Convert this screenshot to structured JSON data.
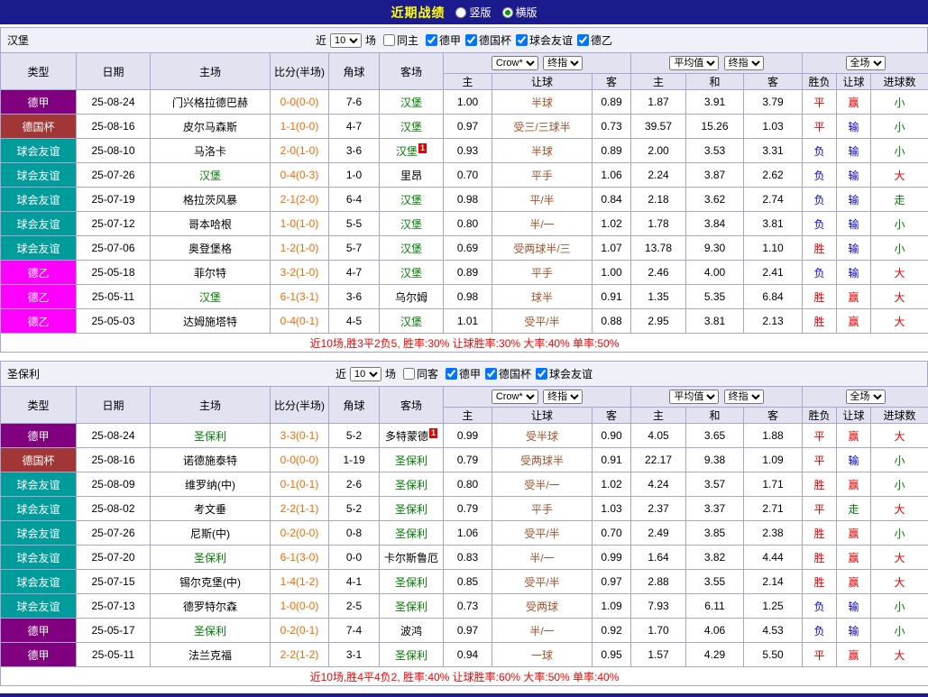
{
  "titlebar": {
    "title": "近期战绩",
    "options": [
      {
        "label": "竖版",
        "selected": false
      },
      {
        "label": "横版",
        "selected": true
      }
    ]
  },
  "labels": {
    "near": "近",
    "games": "场"
  },
  "table_header": {
    "type": "类型",
    "date": "日期",
    "home": "主场",
    "score": "比分(半场)",
    "corner": "角球",
    "away": "客场",
    "dd_company": "Crow*",
    "dd_final": "终指",
    "dd_avg": "平均值",
    "dd_final2": "终指",
    "dd_scope": "全场",
    "sub": [
      "主",
      "让球",
      "客",
      "主",
      "和",
      "客",
      "胜负",
      "让球",
      "进球数"
    ]
  },
  "palette": {
    "league": {
      "德甲": "#800080",
      "德国杯": "#a23535",
      "球会友谊": "#009c9c",
      "德乙": "#ff00ff"
    },
    "result": {
      "red": "#e60000",
      "blue": "#0000e6",
      "green": "#008000"
    },
    "title_bg": "#1b1b8e",
    "title_text": "#ffff00",
    "team_green": "#008000",
    "score_orange": "#ff6600",
    "handicap_brown": "#a0522d",
    "summary_red": "#ff0000",
    "border": "#a6a6ce"
  },
  "sections": [
    {
      "team": "汉堡",
      "filter": {
        "count": "10",
        "same": "同主",
        "same_checked": false,
        "leagues": [
          {
            "label": "德甲",
            "checked": true
          },
          {
            "label": "德国杯",
            "checked": true
          },
          {
            "label": "球会友谊",
            "checked": true
          },
          {
            "label": "德乙",
            "checked": true
          }
        ]
      },
      "rows": [
        {
          "lg": "德甲",
          "dt": "25-08-24",
          "hm": "门兴格拉德巴赫",
          "hs": false,
          "hr": 0,
          "sc": "0-0(0-0)",
          "cn": "7-6",
          "aw": "汉堡",
          "as": true,
          "ar": 0,
          "o1": "1.00",
          "hc": "半球",
          "o2": "0.89",
          "e1": "1.87",
          "e2": "3.91",
          "e3": "3.79",
          "r1": "平",
          "c1": "red",
          "r2": "赢",
          "c2": "red",
          "r3": "小",
          "c3": "green"
        },
        {
          "lg": "德国杯",
          "dt": "25-08-16",
          "hm": "皮尔马森斯",
          "hs": false,
          "hr": 0,
          "sc": "1-1(0-0)",
          "cn": "4-7",
          "aw": "汉堡",
          "as": true,
          "ar": 0,
          "o1": "0.97",
          "hc": "受三/三球半",
          "o2": "0.73",
          "e1": "39.57",
          "e2": "15.26",
          "e3": "1.03",
          "r1": "平",
          "c1": "red",
          "r2": "输",
          "c2": "blue",
          "r3": "小",
          "c3": "green"
        },
        {
          "lg": "球会友谊",
          "dt": "25-08-10",
          "hm": "马洛卡",
          "hs": false,
          "hr": 0,
          "sc": "2-0(1-0)",
          "cn": "3-6",
          "aw": "汉堡",
          "as": true,
          "ar": 1,
          "o1": "0.93",
          "hc": "半球",
          "o2": "0.89",
          "e1": "2.00",
          "e2": "3.53",
          "e3": "3.31",
          "r1": "负",
          "c1": "blue",
          "r2": "输",
          "c2": "blue",
          "r3": "小",
          "c3": "green"
        },
        {
          "lg": "球会友谊",
          "dt": "25-07-26",
          "hm": "汉堡",
          "hs": true,
          "hr": 0,
          "sc": "0-4(0-3)",
          "cn": "1-0",
          "aw": "里昂",
          "as": false,
          "ar": 0,
          "o1": "0.70",
          "hc": "平手",
          "o2": "1.06",
          "e1": "2.24",
          "e2": "3.87",
          "e3": "2.62",
          "r1": "负",
          "c1": "blue",
          "r2": "输",
          "c2": "blue",
          "r3": "大",
          "c3": "red"
        },
        {
          "lg": "球会友谊",
          "dt": "25-07-19",
          "hm": "格拉茨风暴",
          "hs": false,
          "hr": 0,
          "sc": "2-1(2-0)",
          "cn": "6-4",
          "aw": "汉堡",
          "as": true,
          "ar": 0,
          "o1": "0.98",
          "hc": "平/半",
          "o2": "0.84",
          "e1": "2.18",
          "e2": "3.62",
          "e3": "2.74",
          "r1": "负",
          "c1": "blue",
          "r2": "输",
          "c2": "blue",
          "r3": "走",
          "c3": "green"
        },
        {
          "lg": "球会友谊",
          "dt": "25-07-12",
          "hm": "哥本哈根",
          "hs": false,
          "hr": 0,
          "sc": "1-0(1-0)",
          "cn": "5-5",
          "aw": "汉堡",
          "as": true,
          "ar": 0,
          "o1": "0.80",
          "hc": "半/一",
          "o2": "1.02",
          "e1": "1.78",
          "e2": "3.84",
          "e3": "3.81",
          "r1": "负",
          "c1": "blue",
          "r2": "输",
          "c2": "blue",
          "r3": "小",
          "c3": "green"
        },
        {
          "lg": "球会友谊",
          "dt": "25-07-06",
          "hm": "奥登堡格",
          "hs": false,
          "hr": 0,
          "sc": "1-2(1-0)",
          "cn": "5-7",
          "aw": "汉堡",
          "as": true,
          "ar": 0,
          "o1": "0.69",
          "hc": "受两球半/三",
          "o2": "1.07",
          "e1": "13.78",
          "e2": "9.30",
          "e3": "1.10",
          "r1": "胜",
          "c1": "red",
          "r2": "输",
          "c2": "blue",
          "r3": "小",
          "c3": "green"
        },
        {
          "lg": "德乙",
          "dt": "25-05-18",
          "hm": "菲尔特",
          "hs": false,
          "hr": 0,
          "sc": "3-2(1-0)",
          "cn": "4-7",
          "aw": "汉堡",
          "as": true,
          "ar": 0,
          "o1": "0.89",
          "hc": "平手",
          "o2": "1.00",
          "e1": "2.46",
          "e2": "4.00",
          "e3": "2.41",
          "r1": "负",
          "c1": "blue",
          "r2": "输",
          "c2": "blue",
          "r3": "大",
          "c3": "red"
        },
        {
          "lg": "德乙",
          "dt": "25-05-11",
          "hm": "汉堡",
          "hs": true,
          "hr": 0,
          "sc": "6-1(3-1)",
          "cn": "3-6",
          "aw": "乌尔姆",
          "as": false,
          "ar": 0,
          "o1": "0.98",
          "hc": "球半",
          "o2": "0.91",
          "e1": "1.35",
          "e2": "5.35",
          "e3": "6.84",
          "r1": "胜",
          "c1": "red",
          "r2": "赢",
          "c2": "red",
          "r3": "大",
          "c3": "red"
        },
        {
          "lg": "德乙",
          "dt": "25-05-03",
          "hm": "达姆施塔特",
          "hs": false,
          "hr": 0,
          "sc": "0-4(0-1)",
          "cn": "4-5",
          "aw": "汉堡",
          "as": true,
          "ar": 0,
          "o1": "1.01",
          "hc": "受平/半",
          "o2": "0.88",
          "e1": "2.95",
          "e2": "3.81",
          "e3": "2.13",
          "r1": "胜",
          "c1": "red",
          "r2": "赢",
          "c2": "red",
          "r3": "大",
          "c3": "red"
        }
      ],
      "summary": "近10场,胜3平2负5, 胜率:30% 让球胜率:30% 大率:40% 单率:50%"
    },
    {
      "team": "圣保利",
      "filter": {
        "count": "10",
        "same": "同客",
        "same_checked": false,
        "leagues": [
          {
            "label": "德甲",
            "checked": true
          },
          {
            "label": "德国杯",
            "checked": true
          },
          {
            "label": "球会友谊",
            "checked": true
          }
        ]
      },
      "rows": [
        {
          "lg": "德甲",
          "dt": "25-08-24",
          "hm": "圣保利",
          "hs": true,
          "hr": 0,
          "sc": "3-3(0-1)",
          "cn": "5-2",
          "aw": "多特蒙德",
          "as": false,
          "ar": 1,
          "o1": "0.99",
          "hc": "受半球",
          "o2": "0.90",
          "e1": "4.05",
          "e2": "3.65",
          "e3": "1.88",
          "r1": "平",
          "c1": "red",
          "r2": "赢",
          "c2": "red",
          "r3": "大",
          "c3": "red"
        },
        {
          "lg": "德国杯",
          "dt": "25-08-16",
          "hm": "诺德施泰特",
          "hs": false,
          "hr": 0,
          "sc": "0-0(0-0)",
          "cn": "1-19",
          "aw": "圣保利",
          "as": true,
          "ar": 0,
          "o1": "0.79",
          "hc": "受两球半",
          "o2": "0.91",
          "e1": "22.17",
          "e2": "9.38",
          "e3": "1.09",
          "r1": "平",
          "c1": "red",
          "r2": "输",
          "c2": "blue",
          "r3": "小",
          "c3": "green"
        },
        {
          "lg": "球会友谊",
          "dt": "25-08-09",
          "hm": "维罗纳(中)",
          "hs": false,
          "hr": 0,
          "sc": "0-1(0-1)",
          "cn": "2-6",
          "aw": "圣保利",
          "as": true,
          "ar": 0,
          "o1": "0.80",
          "hc": "受半/一",
          "o2": "1.02",
          "e1": "4.24",
          "e2": "3.57",
          "e3": "1.71",
          "r1": "胜",
          "c1": "red",
          "r2": "赢",
          "c2": "red",
          "r3": "小",
          "c3": "green"
        },
        {
          "lg": "球会友谊",
          "dt": "25-08-02",
          "hm": "考文垂",
          "hs": false,
          "hr": 0,
          "sc": "2-2(1-1)",
          "cn": "5-2",
          "aw": "圣保利",
          "as": true,
          "ar": 0,
          "o1": "0.79",
          "hc": "平手",
          "o2": "1.03",
          "e1": "2.37",
          "e2": "3.37",
          "e3": "2.71",
          "r1": "平",
          "c1": "red",
          "r2": "走",
          "c2": "green",
          "r3": "大",
          "c3": "red"
        },
        {
          "lg": "球会友谊",
          "dt": "25-07-26",
          "hm": "尼斯(中)",
          "hs": false,
          "hr": 0,
          "sc": "0-2(0-0)",
          "cn": "0-8",
          "aw": "圣保利",
          "as": true,
          "ar": 0,
          "o1": "1.06",
          "hc": "受平/半",
          "o2": "0.70",
          "e1": "2.49",
          "e2": "3.85",
          "e3": "2.38",
          "r1": "胜",
          "c1": "red",
          "r2": "赢",
          "c2": "red",
          "r3": "小",
          "c3": "green"
        },
        {
          "lg": "球会友谊",
          "dt": "25-07-20",
          "hm": "圣保利",
          "hs": true,
          "hr": 0,
          "sc": "6-1(3-0)",
          "cn": "0-0",
          "aw": "卡尔斯鲁厄",
          "as": false,
          "ar": 0,
          "o1": "0.83",
          "hc": "半/一",
          "o2": "0.99",
          "e1": "1.64",
          "e2": "3.82",
          "e3": "4.44",
          "r1": "胜",
          "c1": "red",
          "r2": "赢",
          "c2": "red",
          "r3": "大",
          "c3": "red"
        },
        {
          "lg": "球会友谊",
          "dt": "25-07-15",
          "hm": "锡尔克堡(中)",
          "hs": false,
          "hr": 0,
          "sc": "1-4(1-2)",
          "cn": "4-1",
          "aw": "圣保利",
          "as": true,
          "ar": 0,
          "o1": "0.85",
          "hc": "受平/半",
          "o2": "0.97",
          "e1": "2.88",
          "e2": "3.55",
          "e3": "2.14",
          "r1": "胜",
          "c1": "red",
          "r2": "赢",
          "c2": "red",
          "r3": "大",
          "c3": "red"
        },
        {
          "lg": "球会友谊",
          "dt": "25-07-13",
          "hm": "德罗特尔森",
          "hs": false,
          "hr": 0,
          "sc": "1-0(0-0)",
          "cn": "2-5",
          "aw": "圣保利",
          "as": true,
          "ar": 0,
          "o1": "0.73",
          "hc": "受两球",
          "o2": "1.09",
          "e1": "7.93",
          "e2": "6.11",
          "e3": "1.25",
          "r1": "负",
          "c1": "blue",
          "r2": "输",
          "c2": "blue",
          "r3": "小",
          "c3": "green"
        },
        {
          "lg": "德甲",
          "dt": "25-05-17",
          "hm": "圣保利",
          "hs": true,
          "hr": 0,
          "sc": "0-2(0-1)",
          "cn": "7-4",
          "aw": "波鸿",
          "as": false,
          "ar": 0,
          "o1": "0.97",
          "hc": "半/一",
          "o2": "0.92",
          "e1": "1.70",
          "e2": "4.06",
          "e3": "4.53",
          "r1": "负",
          "c1": "blue",
          "r2": "输",
          "c2": "blue",
          "r3": "小",
          "c3": "green"
        },
        {
          "lg": "德甲",
          "dt": "25-05-11",
          "hm": "法兰克福",
          "hs": false,
          "hr": 0,
          "sc": "2-2(1-2)",
          "cn": "3-1",
          "aw": "圣保利",
          "as": true,
          "ar": 0,
          "o1": "0.94",
          "hc": "一球",
          "o2": "0.95",
          "e1": "1.57",
          "e2": "4.29",
          "e3": "5.50",
          "r1": "平",
          "c1": "red",
          "r2": "赢",
          "c2": "red",
          "r3": "大",
          "c3": "red"
        }
      ],
      "summary": "近10场,胜4平4负2, 胜率:40% 让球胜率:60% 大率:50% 单率:40%"
    }
  ]
}
